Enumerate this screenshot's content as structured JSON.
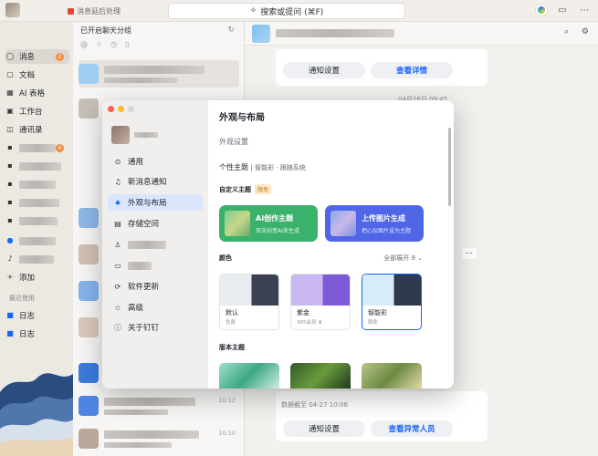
{
  "titlebar": {
    "pending_label": "消息延后处理",
    "search_label": "搜索或提问 (⌘F)"
  },
  "nav": {
    "items": [
      {
        "label": "消息",
        "icon": "chat-icon",
        "badge": "2",
        "active": true
      },
      {
        "label": "文档",
        "icon": "doc-icon"
      },
      {
        "label": "AI 表格",
        "icon": "table-icon"
      },
      {
        "label": "工作台",
        "icon": "workbench-icon"
      },
      {
        "label": "通讯录",
        "icon": "contacts-icon"
      }
    ],
    "extra_badge": "4",
    "add_label": "添加",
    "recent_label": "最近使用",
    "recent_items": [
      "日志",
      "日志"
    ]
  },
  "chatlist": {
    "header": "已开启聊天分组",
    "times": [
      "10:12",
      "10:10"
    ]
  },
  "pane": {
    "card1_buttons": [
      "通知设置",
      "查看详情"
    ],
    "date_stamp": "04月26日 09:45",
    "data_stamp": "数据截至 04-27 10:06",
    "card2_buttons": [
      "通知设置",
      "查看异常人员"
    ]
  },
  "dialog": {
    "menu": [
      {
        "label": "通用",
        "icon": "general-icon"
      },
      {
        "label": "新消息通知",
        "icon": "bell-icon"
      },
      {
        "label": "外观与布局",
        "icon": "shirt-icon",
        "active": true
      },
      {
        "label": "存储空间",
        "icon": "storage-icon"
      },
      {
        "label": "",
        "icon": "user-icon"
      },
      {
        "label": "",
        "icon": "id-card-icon"
      },
      {
        "label": "软件更新",
        "icon": "update-icon"
      },
      {
        "label": "高级",
        "icon": "star-icon"
      },
      {
        "label": "关于钉钉",
        "icon": "info-icon"
      }
    ],
    "title": "外观与布局",
    "subtitle": "外观设置",
    "theme_label": "个性主题",
    "theme_current": "| 智能彩 · 跟随系统",
    "custom_label": "自定义主题",
    "limited_badge": "限免",
    "ai_card": {
      "title": "AI创作主题",
      "subtitle": "双击创意AI来生成"
    },
    "upload_card": {
      "title": "上传图片生成",
      "subtitle": "把心仪图片设为主题"
    },
    "colors_label": "颜色",
    "expand_label": "全部展开 9 ⌄",
    "swatches": [
      {
        "name": "默认",
        "sub": "免费"
      },
      {
        "name": "紫金",
        "sub": "365会员 ♛"
      },
      {
        "name": "智能彩",
        "sub": "限免"
      }
    ],
    "version_label": "版本主题"
  },
  "colors": {
    "accent": "#1664ff",
    "ai_green": "#3bb26b",
    "upload_blue": "#4f67e6",
    "badge_orange": "#f38b3b"
  }
}
